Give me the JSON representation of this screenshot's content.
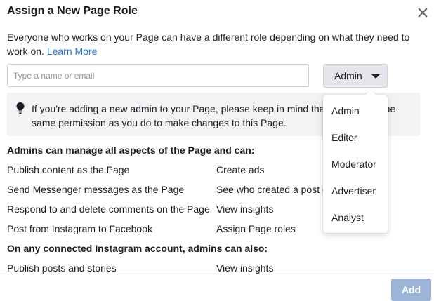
{
  "dialog": {
    "title": "Assign a New Page Role",
    "description": "Everyone who works on your Page can have a different role depending on what they need to work on.",
    "learn_more": "Learn More"
  },
  "input": {
    "placeholder": "Type a name or email",
    "value": ""
  },
  "role_select": {
    "selected": "Admin",
    "options": [
      "Admin",
      "Editor",
      "Moderator",
      "Advertiser",
      "Analyst"
    ]
  },
  "tip": {
    "icon": "lightbulb-icon",
    "text": "If you're adding a new admin to your Page, please keep in mind that they'll have the same permission as you do to make changes to this Page."
  },
  "admin_permissions": {
    "heading": "Admins can manage all aspects of the Page and can:",
    "left": [
      "Publish content as the Page",
      "Send Messenger messages as the Page",
      "Respond to and delete comments on the Page",
      "Post from Instagram to Facebook"
    ],
    "right": [
      "Create ads",
      "See who created a post or comment",
      "View insights",
      "Assign Page roles"
    ]
  },
  "instagram_permissions": {
    "heading": "On any connected Instagram account, admins can also:",
    "left": [
      "Publish posts and stories"
    ],
    "right": [
      "View insights"
    ]
  },
  "footer": {
    "add_label": "Add"
  },
  "colors": {
    "link": "#216fdb",
    "add_button_disabled": "#9cb4d8",
    "tip_background": "#f2f3f5"
  }
}
